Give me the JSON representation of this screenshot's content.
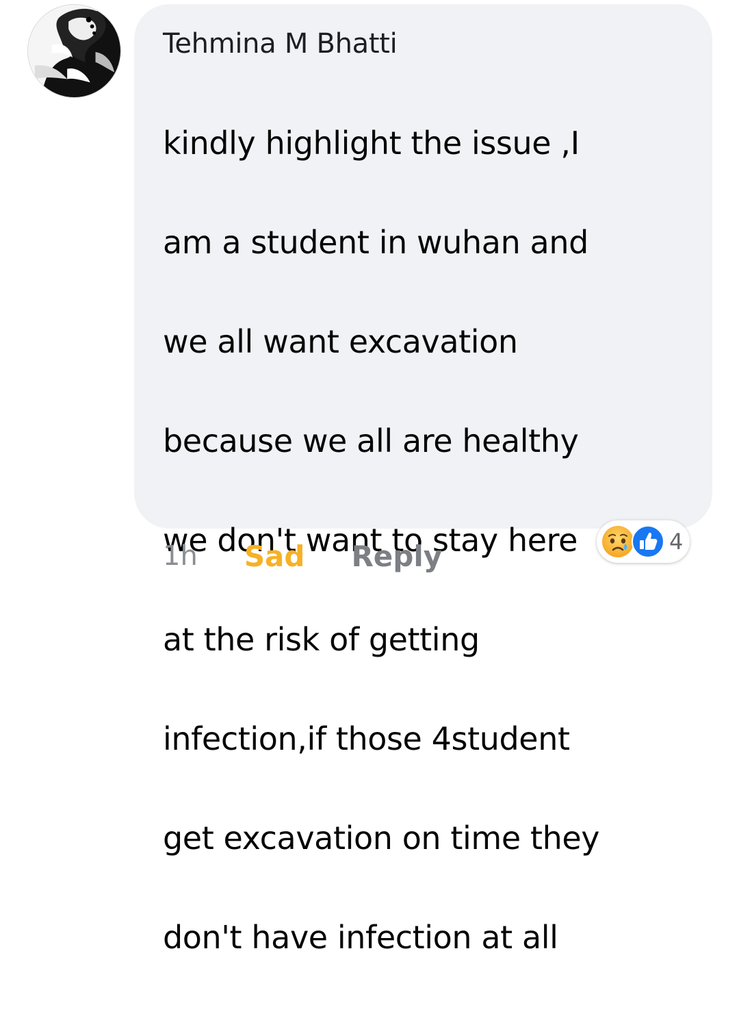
{
  "comment": {
    "author": "Tehmina M Bhatti",
    "avatar_icon": "profile-avatar-image",
    "lines": [
      "kindly highlight the issue ,I",
      "am a student in wuhan and",
      "we all want excavation",
      "because we all are healthy",
      "we don't want to stay here",
      "at the risk of getting",
      "infection,if those 4student",
      "get excavation on time they",
      "don't have infection at all"
    ],
    "bubble_color": "#f0f2f5"
  },
  "actions": {
    "time": "1h",
    "reaction_label": "Sad",
    "reaction_color": "#f7b125",
    "reply_label": "Reply"
  },
  "reactions": {
    "icons": [
      "sad-emoji-icon",
      "like-thumb-icon"
    ],
    "like_color": "#1877f2",
    "count": "4"
  }
}
